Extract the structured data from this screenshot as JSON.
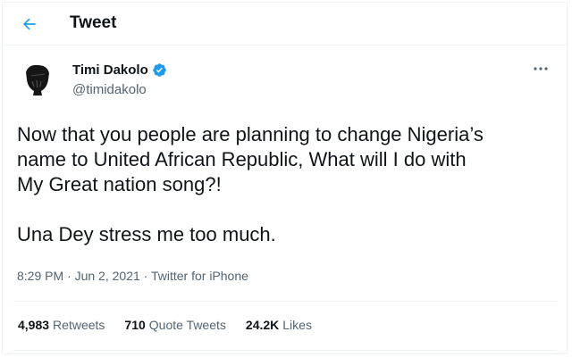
{
  "header": {
    "title": "Tweet"
  },
  "author": {
    "name": "Timi Dakolo",
    "handle": "@timidakolo",
    "verified": true
  },
  "tweet": {
    "text": "Now that you people are planning  to change Nigeria’s\nname to United African Republic, What will I do with\nMy Great nation song?!\n\nUna Dey stress me too much."
  },
  "meta": {
    "time": "8:29 PM",
    "separator1": " · ",
    "date": "Jun 2, 2021",
    "separator2": " · ",
    "source": "Twitter for iPhone"
  },
  "stats": {
    "retweets_count": "4,983",
    "retweets_label": "Retweets",
    "quotes_count": "710",
    "quotes_label": "Quote Tweets",
    "likes_count": "24.2K",
    "likes_label": "Likes"
  },
  "icons": {
    "back": "arrow-left-icon",
    "verified": "verified-badge-icon",
    "more": "more-options-icon"
  },
  "colors": {
    "accent": "#1d9bf0",
    "text": "#0f1419",
    "secondary": "#536471",
    "border": "#eff3f4"
  }
}
